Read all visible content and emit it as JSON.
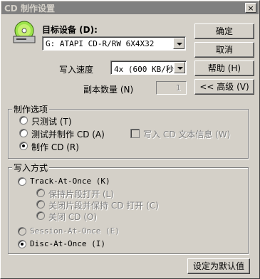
{
  "window": {
    "title": "CD 制作设置",
    "close": "×"
  },
  "device": {
    "label": "目标设备 (D):",
    "value": "G: ATAPI CD-R/RW 6X4X32"
  },
  "speed": {
    "label": "写入速度",
    "value": "4x (600 KB/秒)"
  },
  "copies": {
    "label": "副本数量 (N)",
    "value": "1"
  },
  "buttons": {
    "ok": "确定",
    "cancel": "取消",
    "help": "帮助 (H)",
    "advanced": "<< 高级 (V)",
    "default": "设定为默认值"
  },
  "options": {
    "title": "制作选项",
    "test_only": "只测试 (T)",
    "test_and_make": "测试并制作 CD (A)",
    "make": "制作 CD (R)",
    "write_text": "写入 CD 文本信息 (W)"
  },
  "write_mode": {
    "title": "写入方式",
    "tao": "Track-At-Once (K)",
    "keep_open": "保持片段打开 (L)",
    "close_keep": "关闭片段并保持 CD 打开 (C)",
    "close_cd": "关闭 CD (O)",
    "sao": "Session-At-Once (E)",
    "dao": "Disc-At-Once (I)"
  }
}
